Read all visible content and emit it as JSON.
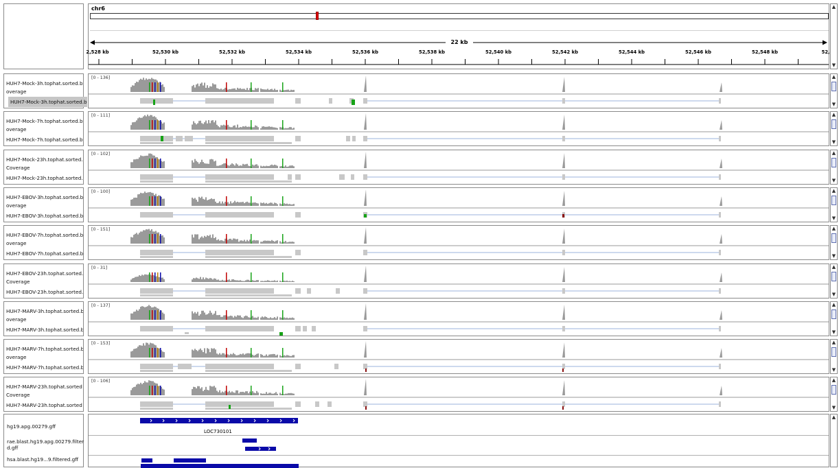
{
  "header": {
    "chromosome": "chr6",
    "span_label": "22 kb",
    "ruler_ticks": [
      "2,528 kb",
      "52,530 kb",
      "52,532 kb",
      "52,534 kb",
      "52,536 kb",
      "52,538 kb",
      "52,540 kb",
      "52,542 kb",
      "52,544 kb",
      "52,546 kb",
      "52,548 kb",
      "52,5"
    ]
  },
  "tracks": [
    {
      "coverage_label": "HUH7-Mock-3h.tophat.sorted.b\noverage",
      "reads_label": "HUH7-Mock-3h.tophat.sorted.b",
      "range": "[0 - 136]",
      "reads_selected": true
    },
    {
      "coverage_label": "HUH7-Mock-7h.tophat.sorted.b\noverage",
      "reads_label": "HUH7-Mock-7h.tophat.sorted.b",
      "range": "[0 - 111]"
    },
    {
      "coverage_label": "HUH7-Mock-23h.tophat.sorted.\nCoverage",
      "reads_label": "HUH7-Mock-23h.tophat.sorted.",
      "range": "[0 - 102]"
    },
    {
      "coverage_label": "HUH7-EBOV-3h.tophat.sorted.b\noverage",
      "reads_label": "HUH7-EBOV-3h.tophat.sorted.b",
      "range": "[0 - 100]"
    },
    {
      "coverage_label": "HUH7-EBOV-7h.tophat.sorted.b\noverage",
      "reads_label": "HUH7-EBOV-7h.tophat.sorted.b",
      "range": "[0 - 151]"
    },
    {
      "coverage_label": "HUH7-EBOV-23h.tophat.sorted.\nCoverage",
      "reads_label": "HUH7-EBOV-23h.tophat.sorted.",
      "range": "[0 - 31]"
    },
    {
      "coverage_label": "HUH7-MARV-3h.tophat.sorted.b\noverage",
      "reads_label": "HUH7-MARV-3h.tophat.sorted.b",
      "range": "[0 - 137]"
    },
    {
      "coverage_label": "HUH7-MARV-7h.tophat.sorted.b\noverage",
      "reads_label": "HUH7-MARV-7h.tophat.sorted.b",
      "range": "[0 - 153]"
    },
    {
      "coverage_label": "HUH7-MARV-23h.tophat.sorted\nCoverage",
      "reads_label": "HUH7-MARV-23h.tophat.sorted",
      "range": "[0 - 106]"
    }
  ],
  "feature_tracks": {
    "track1_label": "hg19.apg.00279.gff",
    "track2_label": "rae.blast.hg19.apg.00279.filtere\nd.gff",
    "track3_label": "hsa.blast.hg19...9.filtered.gff",
    "gene_name": "LOC730101"
  },
  "colors": {
    "coverage_gray": "#9a9a9a",
    "read_gray": "#c8c8c8",
    "feature_blue": "#0a0aa8",
    "mismatch_green": "#17a317",
    "mismatch_red": "#c00000",
    "selected_label_bg": "#c6c6c6",
    "ideogram_marker": "#e00000"
  }
}
